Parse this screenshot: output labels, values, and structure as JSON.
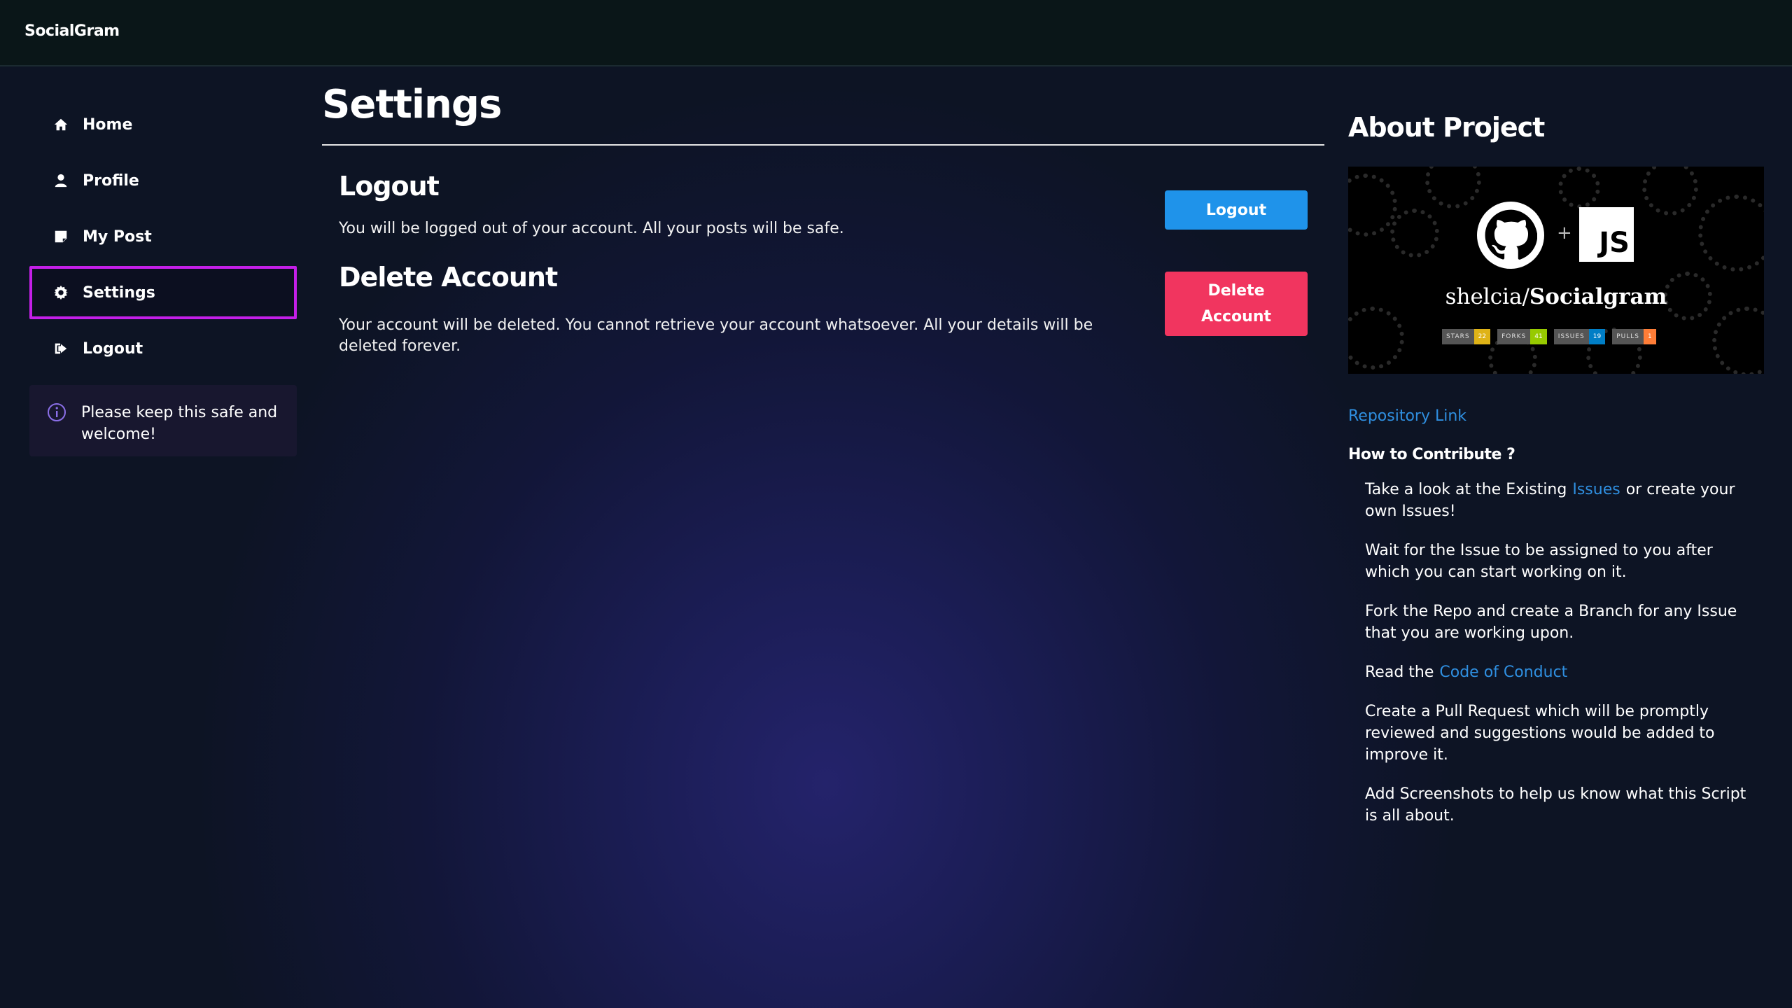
{
  "app": {
    "brand": "SocialGram"
  },
  "sidebar": {
    "items": [
      {
        "label": "Home",
        "icon": "home-icon"
      },
      {
        "label": "Profile",
        "icon": "user-icon"
      },
      {
        "label": "My Post",
        "icon": "note-icon"
      },
      {
        "label": "Settings",
        "icon": "gear-icon",
        "active": true
      },
      {
        "label": "Logout",
        "icon": "sign-out-icon"
      }
    ],
    "info": {
      "text": "Please keep this safe and welcome!",
      "icon": "info-icon"
    }
  },
  "main": {
    "title": "Settings",
    "logout": {
      "title": "Logout",
      "text": "You will be logged out of your account. All your posts will be safe.",
      "button": "Logout"
    },
    "delete": {
      "title": "Delete Account",
      "text": "Your account will be deleted. You cannot retrieve your account whatsoever. All your details will be deleted forever.",
      "button_line1": "Delete",
      "button_line2": "Account"
    }
  },
  "about": {
    "title": "About Project",
    "banner": {
      "repo_owner": "shelcia/",
      "repo_name": "Socialgram",
      "js_label": "JS",
      "plus": "+",
      "badges": [
        {
          "label": "STARS",
          "value": "22",
          "color": "#dfb317"
        },
        {
          "label": "FORKS",
          "value": "41",
          "color": "#97ca00"
        },
        {
          "label": "ISSUES",
          "value": "19",
          "color": "#007ec6"
        },
        {
          "label": "PULLS",
          "value": "1",
          "color": "#fe7d37"
        }
      ]
    },
    "repo_link": "Repository Link",
    "contribute_title": "How to Contribute ?",
    "steps": {
      "s1_pre": "Take a look at the Existing",
      "s1_link": "Issues",
      "s1_post": "or create your own Issues!",
      "s2": "Wait for the Issue to be assigned to you after which you can start working on it.",
      "s3": "Fork the Repo and create a Branch for any Issue that you are working upon.",
      "s4_pre": "Read the",
      "s4_link": "Code of Conduct",
      "s5": "Create a Pull Request which will be promptly reviewed and suggestions would be added to improve it.",
      "s6": "Add Screenshots to help us know what this Script is all about."
    }
  },
  "colors": {
    "active_border": "#c41fe8",
    "primary_button": "#1f93ea",
    "danger_button": "#f1355f",
    "link": "#2f8fe0"
  }
}
